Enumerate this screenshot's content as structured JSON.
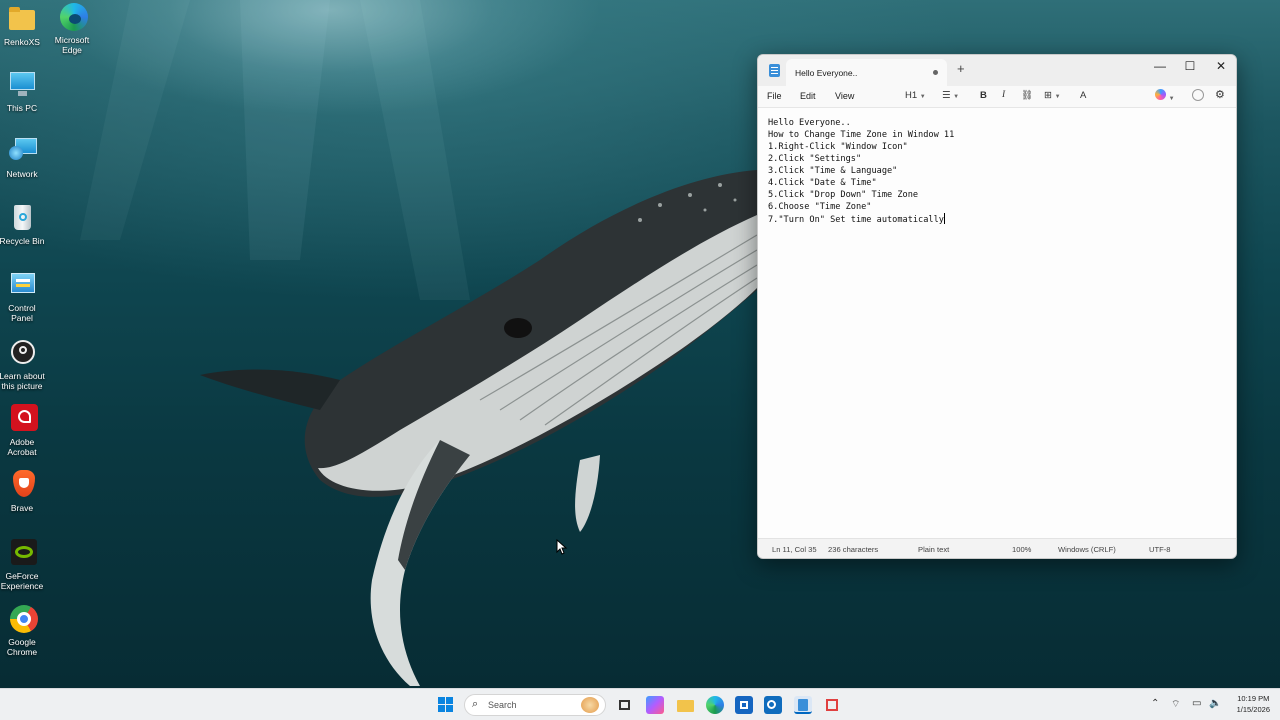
{
  "desktop": {
    "icons": [
      {
        "label": "RenkoXS",
        "icon": "folder-icon"
      },
      {
        "label": "Microsoft Edge",
        "icon": "edge-icon"
      },
      {
        "label": "This PC",
        "icon": "monitor-icon"
      },
      {
        "label": "Network",
        "icon": "network-icon"
      },
      {
        "label": "Recycle Bin",
        "icon": "recycle-bin-icon"
      },
      {
        "label": "Control Panel",
        "icon": "control-panel-icon"
      },
      {
        "label": "Learn about this picture",
        "icon": "camera-icon"
      },
      {
        "label": "Adobe Acrobat",
        "icon": "acrobat-icon"
      },
      {
        "label": "Brave",
        "icon": "brave-icon"
      },
      {
        "label": "GeForce Experience",
        "icon": "geforce-icon"
      },
      {
        "label": "Google Chrome",
        "icon": "chrome-icon"
      }
    ]
  },
  "notepad": {
    "tab_title": "Hello Everyone..",
    "new_tab_glyph": "+",
    "window_controls": {
      "minimize": "—",
      "maximize": "☐",
      "close": "✕"
    },
    "menu": {
      "file": "File",
      "edit": "Edit",
      "view": "View"
    },
    "toolbar": {
      "heading": "H1",
      "list": "☰",
      "bold": "B",
      "italic": "I",
      "link": "⛓",
      "table": "⊞",
      "spellcheck": "A"
    },
    "content": [
      "Hello Everyone..",
      "",
      "How to Change Time Zone in Window 11",
      "",
      "1.Right-Click \"Window Icon\"",
      "2.Click \"Settings\"",
      "3.Click \"Time & Language\"",
      "4.Click \"Date & Time\"",
      "5.Click \"Drop Down\" Time Zone",
      "6.Choose \"Time Zone\"",
      "7.\"Turn On\" Set time automatically"
    ],
    "status": {
      "position": "Ln 11, Col 35",
      "characters": "236 characters",
      "format": "Plain text",
      "zoom": "100%",
      "line_ending": "Windows (CRLF)",
      "encoding": "UTF-8"
    }
  },
  "taskbar": {
    "search_placeholder": "Search",
    "clock_time": "10:19 PM",
    "clock_date": "1/15/2026"
  },
  "colors": {
    "accent": "#0067c0",
    "window_bg": "#f9f9f9",
    "taskbar_bg": "#eef0f2"
  }
}
